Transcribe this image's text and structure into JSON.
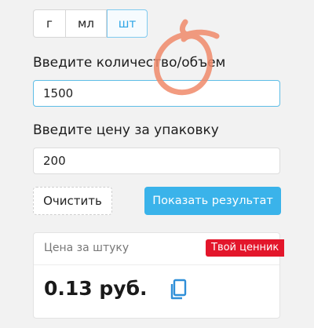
{
  "units": {
    "options": [
      "г",
      "мл",
      "шт"
    ],
    "selected": "шт"
  },
  "quantity": {
    "label": "Введите количество/объем",
    "value": "1500"
  },
  "price": {
    "label": "Введите цену за упаковку",
    "value": "200"
  },
  "actions": {
    "clear_label": "Очистить",
    "show_label": "Показать результат"
  },
  "result": {
    "title": "Цена за штуку",
    "badge": "Твой ценник",
    "value": "0.13 руб."
  },
  "colors": {
    "accent": "#3ab3ea",
    "badge": "#e3162b",
    "annotation": "#f08a6a"
  },
  "icons": {
    "copy": "copy-icon"
  }
}
